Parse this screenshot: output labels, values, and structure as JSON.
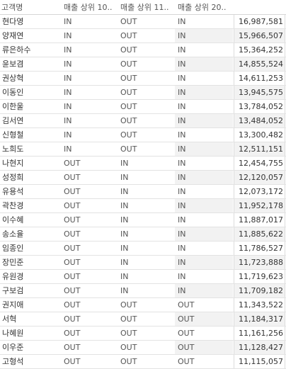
{
  "header": {
    "name": "고객명",
    "flag1": "매출 상위 10..",
    "flag2": "매출 상위 11..",
    "flag3": "매출 상위 20..",
    "amount": ""
  },
  "rows": [
    {
      "name": "현다영",
      "f1": "IN",
      "f2": "OUT",
      "f3": "IN",
      "amount": "16,987,581"
    },
    {
      "name": "양재연",
      "f1": "IN",
      "f2": "OUT",
      "f3": "IN",
      "amount": "15,966,507"
    },
    {
      "name": "류은하수",
      "f1": "IN",
      "f2": "OUT",
      "f3": "IN",
      "amount": "15,364,252"
    },
    {
      "name": "윤보겸",
      "f1": "IN",
      "f2": "OUT",
      "f3": "IN",
      "amount": "14,855,524"
    },
    {
      "name": "권상혁",
      "f1": "IN",
      "f2": "OUT",
      "f3": "IN",
      "amount": "14,611,253"
    },
    {
      "name": "이동인",
      "f1": "IN",
      "f2": "OUT",
      "f3": "IN",
      "amount": "13,945,575"
    },
    {
      "name": "이한울",
      "f1": "IN",
      "f2": "OUT",
      "f3": "IN",
      "amount": "13,784,052"
    },
    {
      "name": "김서연",
      "f1": "IN",
      "f2": "OUT",
      "f3": "IN",
      "amount": "13,484,052"
    },
    {
      "name": "신형철",
      "f1": "IN",
      "f2": "OUT",
      "f3": "IN",
      "amount": "13,300,482"
    },
    {
      "name": "노희도",
      "f1": "IN",
      "f2": "OUT",
      "f3": "IN",
      "amount": "12,511,151"
    },
    {
      "name": "나현지",
      "f1": "OUT",
      "f2": "IN",
      "f3": "IN",
      "amount": "12,454,755"
    },
    {
      "name": "성정희",
      "f1": "OUT",
      "f2": "IN",
      "f3": "IN",
      "amount": "12,120,057"
    },
    {
      "name": "유용석",
      "f1": "OUT",
      "f2": "IN",
      "f3": "IN",
      "amount": "12,073,172"
    },
    {
      "name": "곽찬경",
      "f1": "OUT",
      "f2": "IN",
      "f3": "IN",
      "amount": "11,952,178"
    },
    {
      "name": "이수혜",
      "f1": "OUT",
      "f2": "IN",
      "f3": "IN",
      "amount": "11,887,017"
    },
    {
      "name": "송소율",
      "f1": "OUT",
      "f2": "IN",
      "f3": "IN",
      "amount": "11,885,622"
    },
    {
      "name": "임종인",
      "f1": "OUT",
      "f2": "IN",
      "f3": "IN",
      "amount": "11,786,527"
    },
    {
      "name": "장민준",
      "f1": "OUT",
      "f2": "IN",
      "f3": "IN",
      "amount": "11,723,888"
    },
    {
      "name": "유원경",
      "f1": "OUT",
      "f2": "IN",
      "f3": "IN",
      "amount": "11,719,623"
    },
    {
      "name": "구보검",
      "f1": "OUT",
      "f2": "IN",
      "f3": "IN",
      "amount": "11,709,182"
    },
    {
      "name": "권지애",
      "f1": "OUT",
      "f2": "OUT",
      "f3": "OUT",
      "amount": "11,343,522"
    },
    {
      "name": "서혁",
      "f1": "OUT",
      "f2": "OUT",
      "f3": "OUT",
      "amount": "11,184,317"
    },
    {
      "name": "나혜원",
      "f1": "OUT",
      "f2": "OUT",
      "f3": "OUT",
      "amount": "11,161,256"
    },
    {
      "name": "이우준",
      "f1": "OUT",
      "f2": "OUT",
      "f3": "OUT",
      "amount": "11,128,427"
    },
    {
      "name": "고형석",
      "f1": "OUT",
      "f2": "OUT",
      "f3": "OUT",
      "amount": "11,115,057"
    }
  ],
  "colors": {
    "row_alt": "#f2f2f2",
    "grid_line": "#e3e3e3",
    "text": "#333333"
  }
}
